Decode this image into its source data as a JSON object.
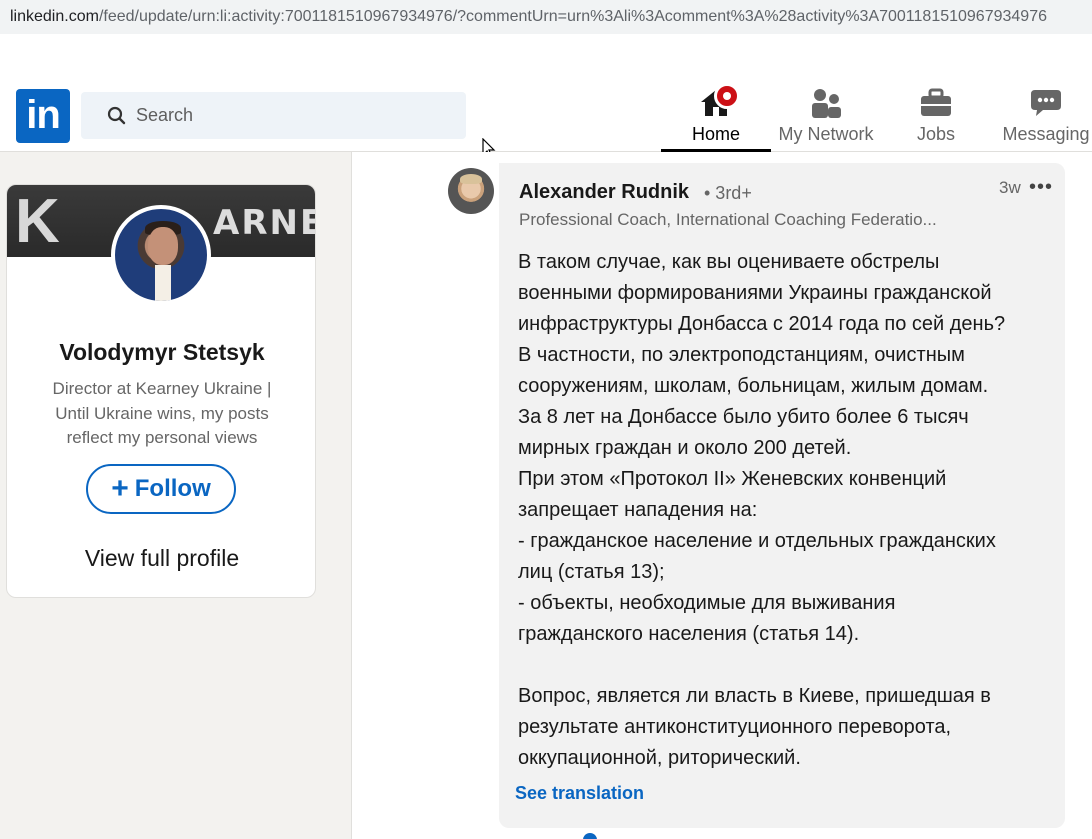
{
  "browser": {
    "url_host": "linkedin.com",
    "url_path": "/feed/update/urn:li:activity:7001181510967934976/?commentUrn=urn%3Ali%3Acomment%3A%28activity%3A7001181510967934976"
  },
  "nav": {
    "search_placeholder": "Search",
    "items": [
      {
        "label": "Home",
        "icon": "home-icon"
      },
      {
        "label": "My Network",
        "icon": "network-icon"
      },
      {
        "label": "Jobs",
        "icon": "briefcase-icon"
      },
      {
        "label": "Messaging",
        "icon": "messaging-icon"
      }
    ],
    "active": "Home",
    "logo_text": "in",
    "brand_color": "#0a66c2",
    "notification_color": "#cc1016"
  },
  "profile_card": {
    "banner_text_large": "K",
    "banner_text_small": "ARNEY",
    "name": "Volodymyr Stetsyk",
    "title": "Director at Kearney Ukraine | Until Ukraine wins, my posts reflect my personal views",
    "follow_label": "Follow",
    "view_profile_label": "View full profile"
  },
  "comment": {
    "author": "Alexander Rudnik",
    "degree": "• 3rd+",
    "time": "3w",
    "more": "•••",
    "headline": "Professional Coach, International Coaching Federatio...",
    "lines": [
      "В таком случае, как вы оцениваете обстрелы",
      "военными формированиями Украины гражданской",
      "инфраструктуры Донбасса с 2014 года по сей день?",
      "В частности, по электроподстанциям, очистным",
      "сооружениям, школам, больницам, жилым домам.",
      "За 8 лет на Донбассе было убито более 6 тысяч",
      "мирных граждан и около 200 детей.",
      "При этом «Протокол II» Женевских конвенций",
      "запрещает нападения на:",
      "- гражданское население и отдельных гражданских",
      "лиц (статья 13);",
      "- объекты, необходимые для выживания",
      "гражданского населения (статья 14).",
      "",
      "Вопрос, является ли власть в Киеве, пришедшая в",
      "результате антиконституционного переворота,",
      "оккупационной, риторический."
    ],
    "see_translation": "See translation"
  }
}
